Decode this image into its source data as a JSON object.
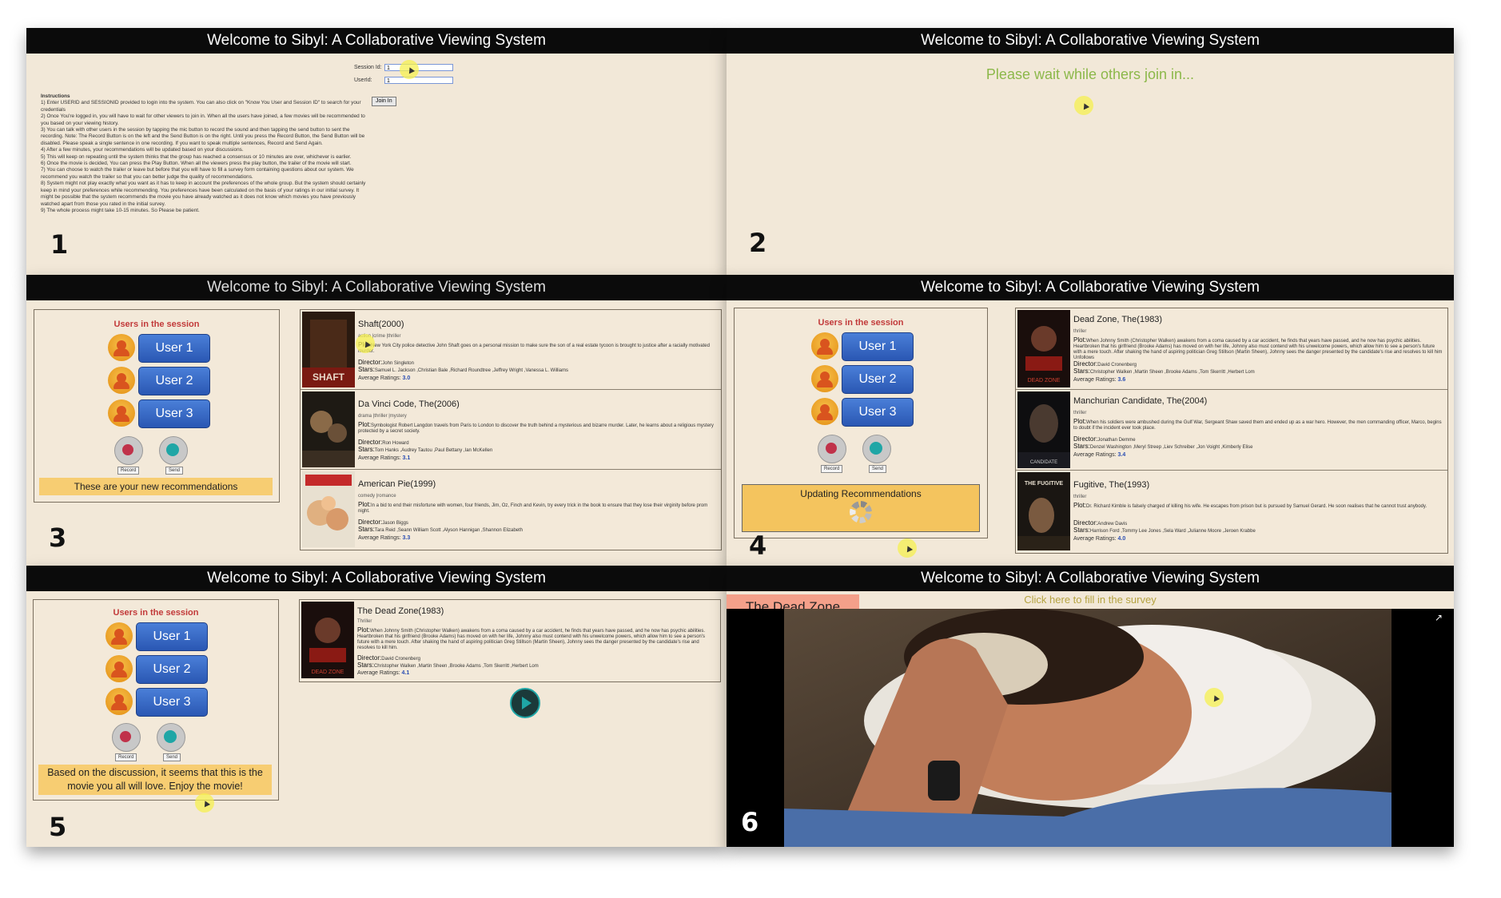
{
  "header_title": "Welcome to Sibyl: A Collaborative Viewing System",
  "step_numbers": [
    "1",
    "2",
    "3",
    "4",
    "5",
    "6"
  ],
  "login": {
    "session_label": "Session Id:",
    "userid_label": "UserId:",
    "session_value": "1",
    "userid_value": "1",
    "join_label": "Join In",
    "instructions_title": "Instructions",
    "instructions": [
      "1) Enter USERID and SESSIONID provided to login into the system. You can also click on \"Know You User and Session ID\" to search for your credentials",
      "2) Once You're logged in, you will have to wait for other viewers to join in. When all the users have joined, a few movies will be recommended to you based on your viewing history.",
      "3) You can talk with other users in the session by tapping the mic button to record the sound and then tapping the send button to sent the recording. Note: The Record Button is on the left and the Send Button is on the right. Until you press the Record Button, the Send Button will be disabled. Please speak a single sentence in one recording. If you want to speak multiple sentences, Record and Send Again.",
      "4) After a few minutes, your recommendations will be updated based on your discussions.",
      "5) This will keep on repeating until the system thinks that the group has reached a consensus or 10 minutes are over, whichever is earlier.",
      "6) Once the movie is decided, You can press the Play Button. When all the viewers press the play button, the trailer of the movie will start.",
      "7) You can choose to watch the trailer or leave but before that you will have to fill a survey form containing questions about our system. We recommend you watch the trailer so that you can better judge the quality of recommendations.",
      "8) System might not play exactly what you want as it has to keep in account the preferences of the whole group. But the system should certainly keep in mind your preferences while recommending. You preferences have been calculated on the basis of your ratings in our initial survey. It might be possible that the system recommends the movie you have already watched as it does not know which movies you have previously watched apart from those you rated in the initial survey.",
      "9) The whole process might take 10-15 minutes. So Please be patient."
    ]
  },
  "waiting_text": "Please wait while others join in...",
  "users_title": "Users in the session",
  "users": [
    "User 1",
    "User 2",
    "User 3"
  ],
  "record_label": "Record",
  "send_label": "Send",
  "new_recs_msg": "These are your new recommendations",
  "updating_msg": "Updating Recommendations",
  "final_msg": "Based on the discussion, it seems that this is the movie you all will love. Enjoy the movie!",
  "labels": {
    "plot": "Plot:",
    "director": "Director:",
    "stars": "Stars:",
    "avg": "Average Ratings:"
  },
  "movies_round1": [
    {
      "title": "Shaft(2000)",
      "genre": "action |crime |thriller",
      "plot": "New York City police detective John Shaft goes on a personal mission to make sure the son of a real estate tycoon is brought to justice after a racially motivated murder.",
      "director": "John Singleton",
      "stars": "Samuel L. Jackson ,Christian Bale ,Richard Roundtree ,Jeffrey Wright ,Vanessa L. Williams",
      "rating": "3.0"
    },
    {
      "title": "Da Vinci Code, The(2006)",
      "genre": "drama |thriller |mystery",
      "plot": "Symbologist Robert Langdon travels from Paris to London to discover the truth behind a mysterious and bizarre murder. Later, he learns about a religious mystery protected by a secret society.",
      "director": "Ron Howard",
      "stars": "Tom Hanks ,Audrey Tautou ,Paul Bettany ,Ian McKellen",
      "rating": "3.1"
    },
    {
      "title": "American Pie(1999)",
      "genre": "comedy |romance",
      "plot": "In a bid to end their misfortune with women, four friends, Jim, Oz, Finch and Kevin, try every trick in the book to ensure that they lose their virginity before prom night.",
      "director": "Jason Biggs",
      "stars": "Tara Reid ,Seann William Scott ,Alyson Hannigan ,Shannon Elizabeth",
      "rating": "3.3"
    }
  ],
  "movies_round2": [
    {
      "title": "Dead Zone, The(1983)",
      "genre": "thriller",
      "plot": "When Johnny Smith (Christopher Walken) awakens from a coma caused by a car accident, he finds that years have passed, and he now has psychic abilities. Heartbroken that his girlfriend (Brooke Adams) has moved on with her life, Johnny also must contend with his unwelcome powers, which allow him to see a person's future with a mere touch. After shaking the hand of aspiring politician Greg Stillson (Martin Sheen), Johnny sees the danger presented by the candidate's rise and resolves to kill him Unfollows",
      "director": "David Cronenberg",
      "stars": "Christopher Walken ,Martin Sheen ,Brooke Adams ,Tom Skerritt ,Herbert Lom",
      "rating": "3.6"
    },
    {
      "title": "Manchurian Candidate, The(2004)",
      "genre": "thriller",
      "plot": "When his soldiers were ambushed during the Gulf War, Sergeant Shaw saved them and ended up as a war hero. However, the men commanding officer, Marco, begins to doubt if the incident ever took place.",
      "director": "Jonathan Demme",
      "stars": "Denzel Washington ,Meryl Streep ,Liev Schreiber ,Jon Voight ,Kimberly Elise",
      "rating": "3.4"
    },
    {
      "title": "Fugitive, The(1993)",
      "genre": "thriller",
      "plot": "Dr. Richard Kimble is falsely charged of killing his wife. He escapes from prison but is pursued by Samuel Gerard. He soon realises that he cannot trust anybody.",
      "director": "Andrew Davis",
      "stars": "Harrison Ford ,Tommy Lee Jones ,Sela Ward ,Julianne Moore ,Jeroen Krabbe",
      "rating": "4.0"
    }
  ],
  "final_movie": {
    "title": "The Dead Zone(1983)",
    "genre": "Thriller",
    "plot": "When Johnny Smith (Christopher Walken) awakens from a coma caused by a car accident, he finds that years have passed, and he now has psychic abilities. Heartbroken that his girlfriend (Brooke Adams) has moved on with her life, Johnny also must contend with his unwelcome powers, which allow him to see a person's future with a mere touch. After shaking the hand of aspiring politician Greg Stillson (Martin Sheen), Johnny sees the danger presented by the candidate's rise and resolves to kill him.",
    "director": "David Cronenberg",
    "stars": "Christopher Walken ,Martin Sheen ,Brooke Adams ,Tom Skerritt ,Herbert Lom",
    "rating": "4.1"
  },
  "player": {
    "tab_title": "The Dead Zone",
    "survey_link": "Click here to fill in the survey"
  },
  "colors": {
    "header_bg": "#0b0b0b",
    "panel_bg": "#f2e8d8",
    "user_button": "#2a57b3",
    "message_bg": "#f7cd72",
    "waiting_text": "#8cb84a",
    "users_title": "#c23a3a",
    "tab_bg": "#f4a08a",
    "survey_link": "#b5a341"
  },
  "icons": [
    "user-avatar-icon",
    "mic-record-icon",
    "send-stop-icon",
    "play-icon",
    "loading-spinner-icon",
    "share-icon",
    "mouse-pointer-icon"
  ]
}
